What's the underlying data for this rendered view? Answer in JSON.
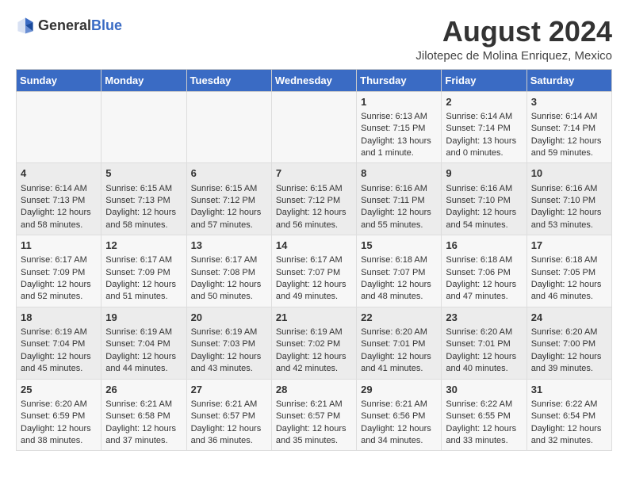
{
  "header": {
    "logo_general": "General",
    "logo_blue": "Blue",
    "month_year": "August 2024",
    "location": "Jilotepec de Molina Enriquez, Mexico"
  },
  "weekdays": [
    "Sunday",
    "Monday",
    "Tuesday",
    "Wednesday",
    "Thursday",
    "Friday",
    "Saturday"
  ],
  "weeks": [
    [
      {
        "day": "",
        "sunrise": "",
        "sunset": "",
        "daylight": ""
      },
      {
        "day": "",
        "sunrise": "",
        "sunset": "",
        "daylight": ""
      },
      {
        "day": "",
        "sunrise": "",
        "sunset": "",
        "daylight": ""
      },
      {
        "day": "",
        "sunrise": "",
        "sunset": "",
        "daylight": ""
      },
      {
        "day": "1",
        "sunrise": "Sunrise: 6:13 AM",
        "sunset": "Sunset: 7:15 PM",
        "daylight": "Daylight: 13 hours and 1 minute."
      },
      {
        "day": "2",
        "sunrise": "Sunrise: 6:14 AM",
        "sunset": "Sunset: 7:14 PM",
        "daylight": "Daylight: 13 hours and 0 minutes."
      },
      {
        "day": "3",
        "sunrise": "Sunrise: 6:14 AM",
        "sunset": "Sunset: 7:14 PM",
        "daylight": "Daylight: 12 hours and 59 minutes."
      }
    ],
    [
      {
        "day": "4",
        "sunrise": "Sunrise: 6:14 AM",
        "sunset": "Sunset: 7:13 PM",
        "daylight": "Daylight: 12 hours and 58 minutes."
      },
      {
        "day": "5",
        "sunrise": "Sunrise: 6:15 AM",
        "sunset": "Sunset: 7:13 PM",
        "daylight": "Daylight: 12 hours and 58 minutes."
      },
      {
        "day": "6",
        "sunrise": "Sunrise: 6:15 AM",
        "sunset": "Sunset: 7:12 PM",
        "daylight": "Daylight: 12 hours and 57 minutes."
      },
      {
        "day": "7",
        "sunrise": "Sunrise: 6:15 AM",
        "sunset": "Sunset: 7:12 PM",
        "daylight": "Daylight: 12 hours and 56 minutes."
      },
      {
        "day": "8",
        "sunrise": "Sunrise: 6:16 AM",
        "sunset": "Sunset: 7:11 PM",
        "daylight": "Daylight: 12 hours and 55 minutes."
      },
      {
        "day": "9",
        "sunrise": "Sunrise: 6:16 AM",
        "sunset": "Sunset: 7:10 PM",
        "daylight": "Daylight: 12 hours and 54 minutes."
      },
      {
        "day": "10",
        "sunrise": "Sunrise: 6:16 AM",
        "sunset": "Sunset: 7:10 PM",
        "daylight": "Daylight: 12 hours and 53 minutes."
      }
    ],
    [
      {
        "day": "11",
        "sunrise": "Sunrise: 6:17 AM",
        "sunset": "Sunset: 7:09 PM",
        "daylight": "Daylight: 12 hours and 52 minutes."
      },
      {
        "day": "12",
        "sunrise": "Sunrise: 6:17 AM",
        "sunset": "Sunset: 7:09 PM",
        "daylight": "Daylight: 12 hours and 51 minutes."
      },
      {
        "day": "13",
        "sunrise": "Sunrise: 6:17 AM",
        "sunset": "Sunset: 7:08 PM",
        "daylight": "Daylight: 12 hours and 50 minutes."
      },
      {
        "day": "14",
        "sunrise": "Sunrise: 6:17 AM",
        "sunset": "Sunset: 7:07 PM",
        "daylight": "Daylight: 12 hours and 49 minutes."
      },
      {
        "day": "15",
        "sunrise": "Sunrise: 6:18 AM",
        "sunset": "Sunset: 7:07 PM",
        "daylight": "Daylight: 12 hours and 48 minutes."
      },
      {
        "day": "16",
        "sunrise": "Sunrise: 6:18 AM",
        "sunset": "Sunset: 7:06 PM",
        "daylight": "Daylight: 12 hours and 47 minutes."
      },
      {
        "day": "17",
        "sunrise": "Sunrise: 6:18 AM",
        "sunset": "Sunset: 7:05 PM",
        "daylight": "Daylight: 12 hours and 46 minutes."
      }
    ],
    [
      {
        "day": "18",
        "sunrise": "Sunrise: 6:19 AM",
        "sunset": "Sunset: 7:04 PM",
        "daylight": "Daylight: 12 hours and 45 minutes."
      },
      {
        "day": "19",
        "sunrise": "Sunrise: 6:19 AM",
        "sunset": "Sunset: 7:04 PM",
        "daylight": "Daylight: 12 hours and 44 minutes."
      },
      {
        "day": "20",
        "sunrise": "Sunrise: 6:19 AM",
        "sunset": "Sunset: 7:03 PM",
        "daylight": "Daylight: 12 hours and 43 minutes."
      },
      {
        "day": "21",
        "sunrise": "Sunrise: 6:19 AM",
        "sunset": "Sunset: 7:02 PM",
        "daylight": "Daylight: 12 hours and 42 minutes."
      },
      {
        "day": "22",
        "sunrise": "Sunrise: 6:20 AM",
        "sunset": "Sunset: 7:01 PM",
        "daylight": "Daylight: 12 hours and 41 minutes."
      },
      {
        "day": "23",
        "sunrise": "Sunrise: 6:20 AM",
        "sunset": "Sunset: 7:01 PM",
        "daylight": "Daylight: 12 hours and 40 minutes."
      },
      {
        "day": "24",
        "sunrise": "Sunrise: 6:20 AM",
        "sunset": "Sunset: 7:00 PM",
        "daylight": "Daylight: 12 hours and 39 minutes."
      }
    ],
    [
      {
        "day": "25",
        "sunrise": "Sunrise: 6:20 AM",
        "sunset": "Sunset: 6:59 PM",
        "daylight": "Daylight: 12 hours and 38 minutes."
      },
      {
        "day": "26",
        "sunrise": "Sunrise: 6:21 AM",
        "sunset": "Sunset: 6:58 PM",
        "daylight": "Daylight: 12 hours and 37 minutes."
      },
      {
        "day": "27",
        "sunrise": "Sunrise: 6:21 AM",
        "sunset": "Sunset: 6:57 PM",
        "daylight": "Daylight: 12 hours and 36 minutes."
      },
      {
        "day": "28",
        "sunrise": "Sunrise: 6:21 AM",
        "sunset": "Sunset: 6:57 PM",
        "daylight": "Daylight: 12 hours and 35 minutes."
      },
      {
        "day": "29",
        "sunrise": "Sunrise: 6:21 AM",
        "sunset": "Sunset: 6:56 PM",
        "daylight": "Daylight: 12 hours and 34 minutes."
      },
      {
        "day": "30",
        "sunrise": "Sunrise: 6:22 AM",
        "sunset": "Sunset: 6:55 PM",
        "daylight": "Daylight: 12 hours and 33 minutes."
      },
      {
        "day": "31",
        "sunrise": "Sunrise: 6:22 AM",
        "sunset": "Sunset: 6:54 PM",
        "daylight": "Daylight: 12 hours and 32 minutes."
      }
    ]
  ]
}
